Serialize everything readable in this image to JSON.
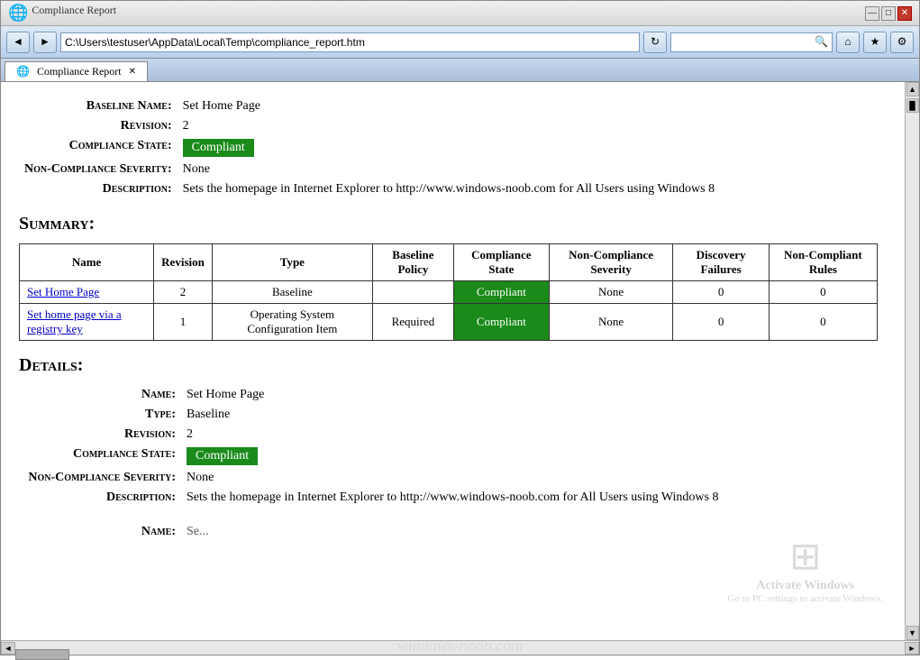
{
  "browser": {
    "title": "Compliance Report",
    "address": "C:\\Users\\testuser\\AppData\\Local\\Temp\\compliance_report.htm",
    "tab_label": "Compliance Report",
    "back_icon": "◄",
    "forward_icon": "►",
    "refresh_icon": "↻",
    "close_icon": "✕",
    "minimize_icon": "—",
    "maximize_icon": "□",
    "home_icon": "⌂",
    "favorites_icon": "★",
    "tools_icon": "⚙"
  },
  "page": {
    "baseline_name_label": "Baseline Name:",
    "baseline_name_value": "Set Home Page",
    "revision_label": "Revision:",
    "revision_value": "2",
    "compliance_state_label": "Compliance State:",
    "compliance_state_value": "Compliant",
    "non_compliance_severity_label": "Non-Compliance Severity:",
    "non_compliance_severity_value": "None",
    "description_label": "Description:",
    "description_value": "Sets the homepage in Internet Explorer to http://www.windows-noob.com for All Users using Windows 8",
    "summary_heading": "Summary:",
    "details_heading": "Details:",
    "table": {
      "headers": [
        "Name",
        "Revision",
        "Type",
        "Baseline Policy",
        "Compliance State",
        "Non-Compliance Severity",
        "Discovery Failures",
        "Non-Compliant Rules"
      ],
      "rows": [
        {
          "name": "Set Home Page",
          "name_link": true,
          "revision": "2",
          "type": "Baseline",
          "baseline_policy": "",
          "compliance_state": "Compliant",
          "non_compliance_severity": "None",
          "discovery_failures": "0",
          "non_compliant_rules": "0"
        },
        {
          "name": "Set home page via a registry key",
          "name_link": true,
          "revision": "1",
          "type": "Operating System Configuration Item",
          "baseline_policy": "Required",
          "compliance_state": "Compliant",
          "non_compliance_severity": "None",
          "discovery_failures": "0",
          "non_compliant_rules": "0"
        }
      ]
    },
    "details": {
      "name_label": "Name:",
      "name_value": "Set Home Page",
      "type_label": "Type:",
      "type_value": "Baseline",
      "revision_label": "Revision:",
      "revision_value": "2",
      "compliance_state_label": "Compliance State:",
      "compliance_state_value": "Compliant",
      "non_compliance_severity_label": "Non-Compliance Severity:",
      "non_compliance_severity_value": "None",
      "description_label": "Description:",
      "description_value": "Sets the homepage in Internet Explorer to http://www.windows-noob.com for All Users using Windows 8"
    },
    "activate_windows_text": "Activate Windows",
    "activate_windows_sub": "Go to PC settings to activate Windows.",
    "windows_noob_watermark": "windows-noob.com"
  }
}
